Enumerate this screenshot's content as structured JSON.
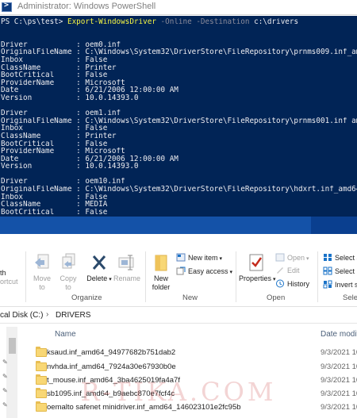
{
  "powershell": {
    "title": "Administrator: Windows PowerShell",
    "prompt": "PS C:\\ps\\test> ",
    "command": {
      "cmdlet": "Export-WindowsDriver",
      "param1": "-Online",
      "param2": "-Destination",
      "arg": "c:\\drivers"
    },
    "drivers": [
      {
        "driver": "Driver           : oem0.inf",
        "original": "OriginalFileName : C:\\Windows\\System32\\DriverStore\\FileRepository\\prnms009.inf_amd",
        "inbox": "Inbox            : False",
        "classname": "ClassName        : Printer",
        "bootcritical": "BootCritical     : False",
        "provider": "ProviderName     : Microsoft",
        "date": "Date             : 6/21/2006 12:00:00 AM",
        "version": "Version          : 10.0.14393.0"
      },
      {
        "driver": "Driver           : oem1.inf",
        "original": "OriginalFileName : C:\\Windows\\System32\\DriverStore\\FileRepository\\prnms001.inf_amd",
        "inbox": "Inbox            : False",
        "classname": "ClassName        : Printer",
        "bootcritical": "BootCritical     : False",
        "provider": "ProviderName     : Microsoft",
        "date": "Date             : 6/21/2006 12:00:00 AM",
        "version": "Version          : 10.0.14393.0"
      },
      {
        "driver": "Driver           : oem10.inf",
        "original": "OriginalFileName : C:\\Windows\\System32\\DriverStore\\FileRepository\\hdxrt.inf_amd64_",
        "inbox": "Inbox            : False",
        "classname": "ClassName        : MEDIA",
        "bootcritical": "BootCritical     : False"
      }
    ]
  },
  "ribbon": {
    "left_partial": {
      "top": "th",
      "bottom": "ortcut"
    },
    "organize": {
      "move_to": [
        "Move",
        "to"
      ],
      "copy_to": [
        "Copy",
        "to"
      ],
      "delete": "Delete",
      "rename": "Rename",
      "label": "Organize"
    },
    "new": {
      "new_folder": [
        "New",
        "folder"
      ],
      "new_item": "New item",
      "easy_access": "Easy access",
      "label": "New"
    },
    "open": {
      "properties": "Properties",
      "open": "Open",
      "edit": "Edit",
      "history": "History",
      "label": "Open"
    },
    "select": {
      "select_all": "Select a",
      "select_none": "Select n",
      "invert": "Invert s",
      "label": "Sele"
    }
  },
  "address": {
    "segment1": "cal Disk (C:)",
    "separator": "›",
    "segment2": "DRIVERS"
  },
  "file_list": {
    "col_name": "Name",
    "col_date": "Date modified",
    "rows": [
      {
        "name": "ksaud.inf_amd64_94977682b751dab2",
        "date": "9/3/2021 10"
      },
      {
        "name": "nvhda.inf_amd64_7924a30e67930b0e",
        "date": "9/3/2021 10"
      },
      {
        "name": "t_mouse.inf_amd64_3ba4625019fa4a7f",
        "date": "9/3/2021 10"
      },
      {
        "name": "sb1095.inf_amd64_b9aebc870e7fcf4c",
        "date": "9/3/2021 10"
      },
      {
        "name": "oemalto safenet minidriver.inf_amd64_146023101e2fc95b",
        "date": "9/3/2021 10"
      }
    ]
  },
  "watermark": "R-TIKA.COM",
  "colors": {
    "console_bg": "#012456",
    "console_fg": "#eeedf0",
    "cmdlet": "#f5f543",
    "param": "#8b8b9a",
    "scrollbar": "#1452a8",
    "folder": "#f8d775",
    "accent_blue": "#1a73c8",
    "delete_x": "#2b4a6b",
    "properties_check": "#c42b1c"
  }
}
